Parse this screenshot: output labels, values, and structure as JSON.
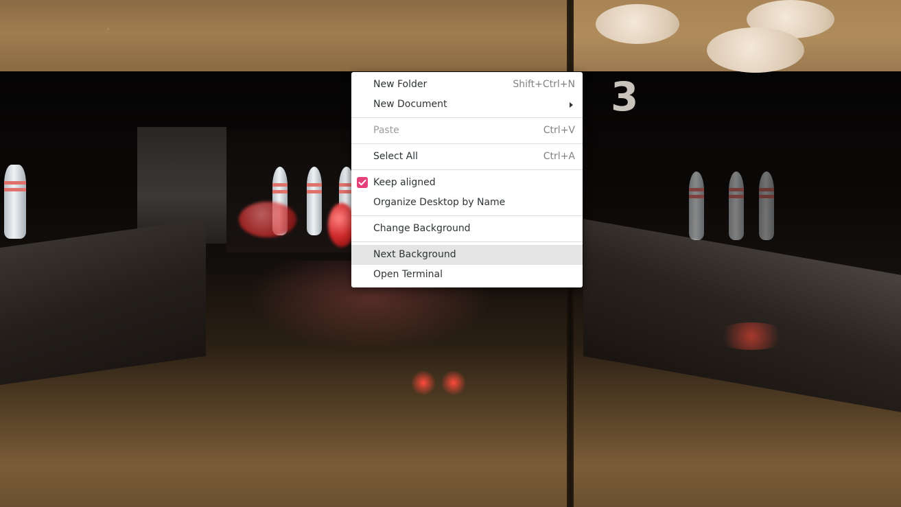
{
  "desktop": {
    "wallpaper_lane_number": "3"
  },
  "context_menu": {
    "items": [
      {
        "label": "New Folder",
        "shortcut": "Shift+Ctrl+N"
      },
      {
        "label": "New Document",
        "submenu": true
      },
      {
        "label": "Paste",
        "shortcut": "Ctrl+V",
        "disabled": true
      },
      {
        "label": "Select All",
        "shortcut": "Ctrl+A"
      },
      {
        "label": "Keep aligned",
        "checked": true
      },
      {
        "label": "Organize Desktop by Name"
      },
      {
        "label": "Change Background"
      },
      {
        "label": "Next Background",
        "highlighted": true
      },
      {
        "label": "Open Terminal"
      }
    ],
    "check_color": "#e5407a",
    "highlight_color": "#e4e4e4"
  }
}
